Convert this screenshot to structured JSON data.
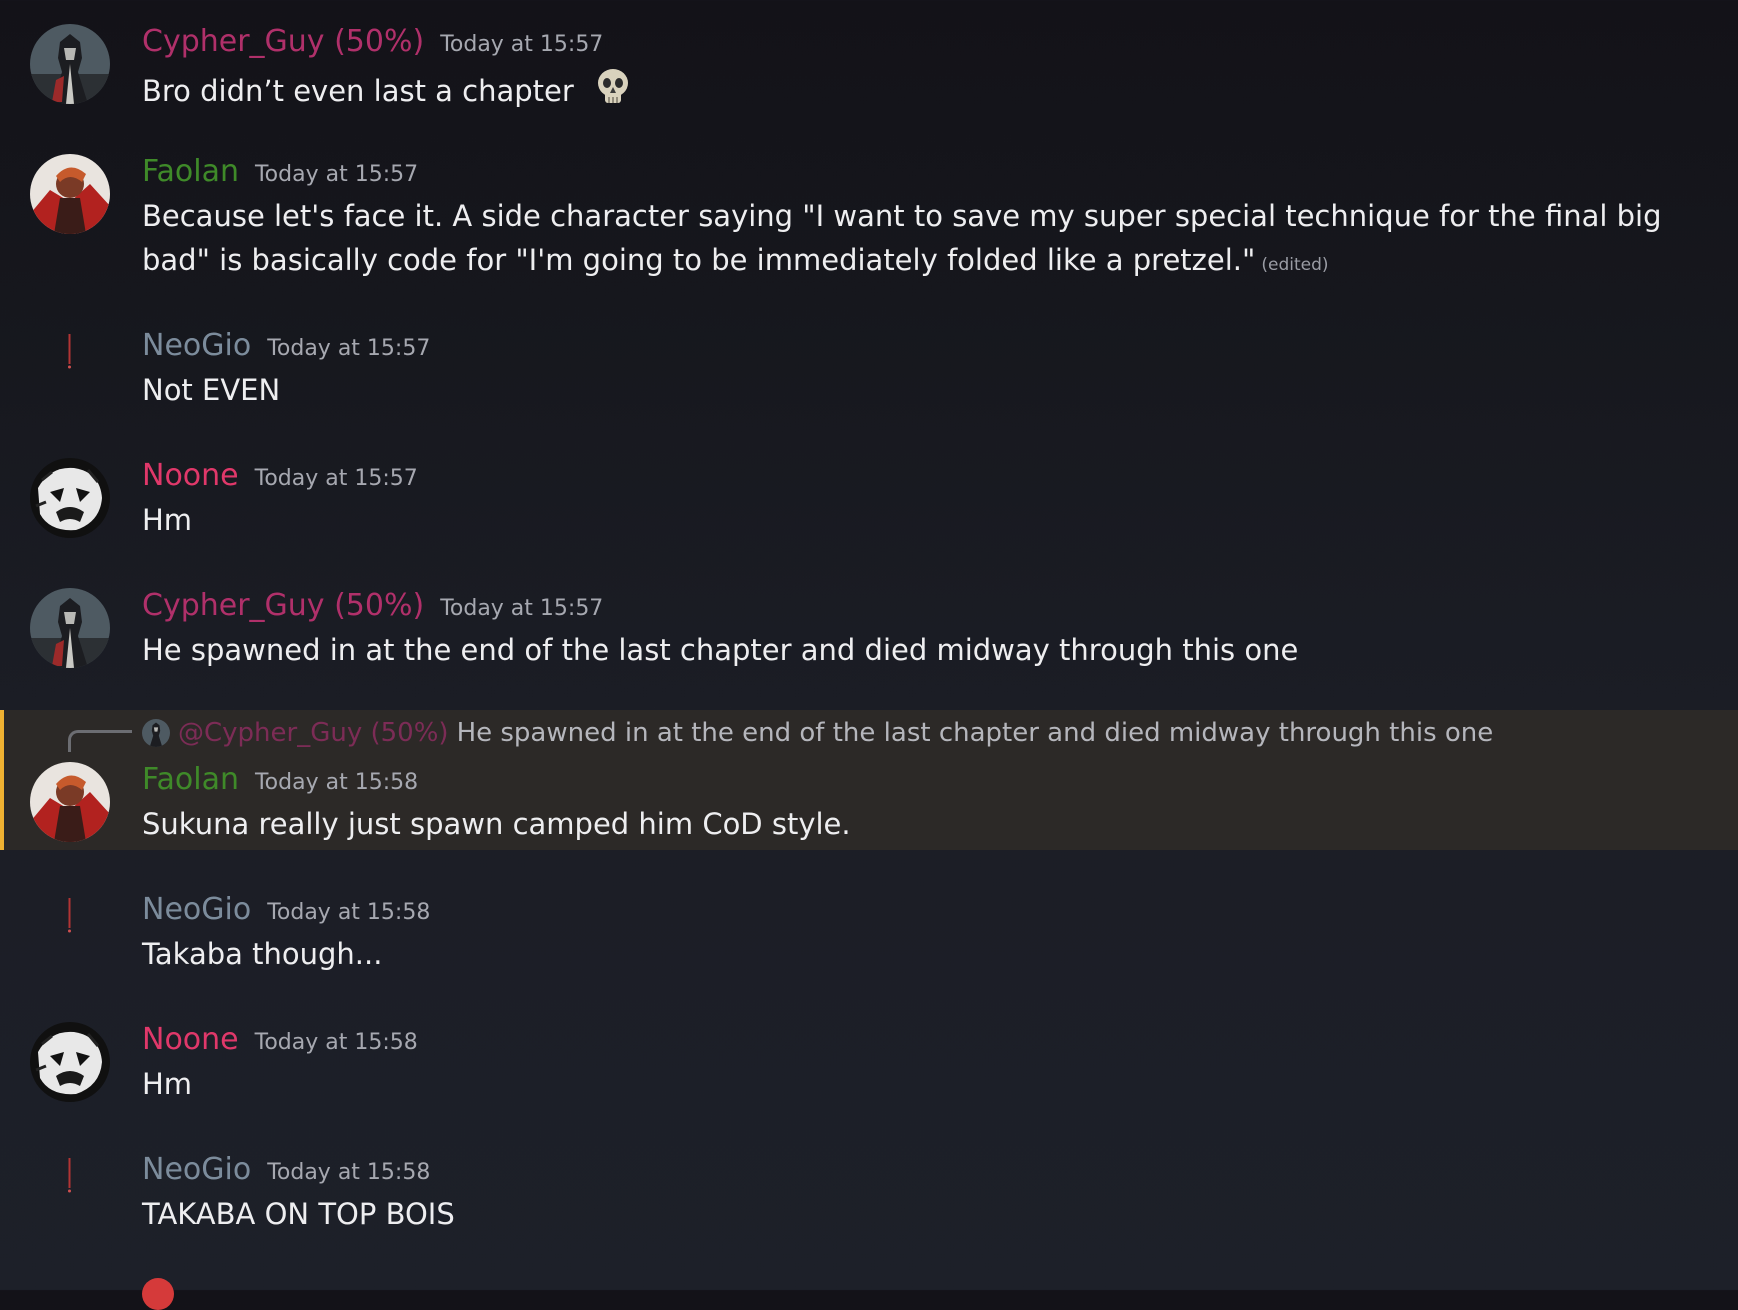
{
  "colors": {
    "cypher": "#b0306a",
    "faolan": "#3f8a29",
    "neogio": "#7c8c9c",
    "noone": "#e0386a",
    "mention": "#7c2c56",
    "highlight_border": "#f0b232"
  },
  "messages": [
    {
      "username": "Cypher_Guy (50%)",
      "timestamp": "Today at 15:57",
      "text": "Bro didn’t even last a chapter",
      "emoji": "skull-emoji"
    },
    {
      "username": "Faolan",
      "timestamp": "Today at 15:57",
      "text": "Because let's face it. A side character saying \"I want to save my super special technique for the final big bad\" is basically code for \"I'm going to be immediately folded like a pretzel.\"",
      "edited": "(edited)"
    },
    {
      "username": "NeoGio",
      "timestamp": "Today at 15:57",
      "text": "Not EVEN"
    },
    {
      "username": "Noone",
      "timestamp": "Today at 15:57",
      "text": "Hm"
    },
    {
      "username": "Cypher_Guy (50%)",
      "timestamp": "Today at 15:57",
      "text": "He spawned in at the end of the last chapter and died midway through this one"
    },
    {
      "username": "Faolan",
      "timestamp": "Today at 15:58",
      "text": "Sukuna really just spawn camped him CoD style.",
      "reply": {
        "mention": "@Cypher_Guy (50%)",
        "text": "He spawned in at the end of the last chapter and died midway through this one"
      }
    },
    {
      "username": "NeoGio",
      "timestamp": "Today at 15:58",
      "text": "Takaba though..."
    },
    {
      "username": "Noone",
      "timestamp": "Today at 15:58",
      "text": "Hm"
    },
    {
      "username": "NeoGio",
      "timestamp": "Today at 15:58",
      "text": "TAKABA ON TOP BOIS"
    }
  ]
}
